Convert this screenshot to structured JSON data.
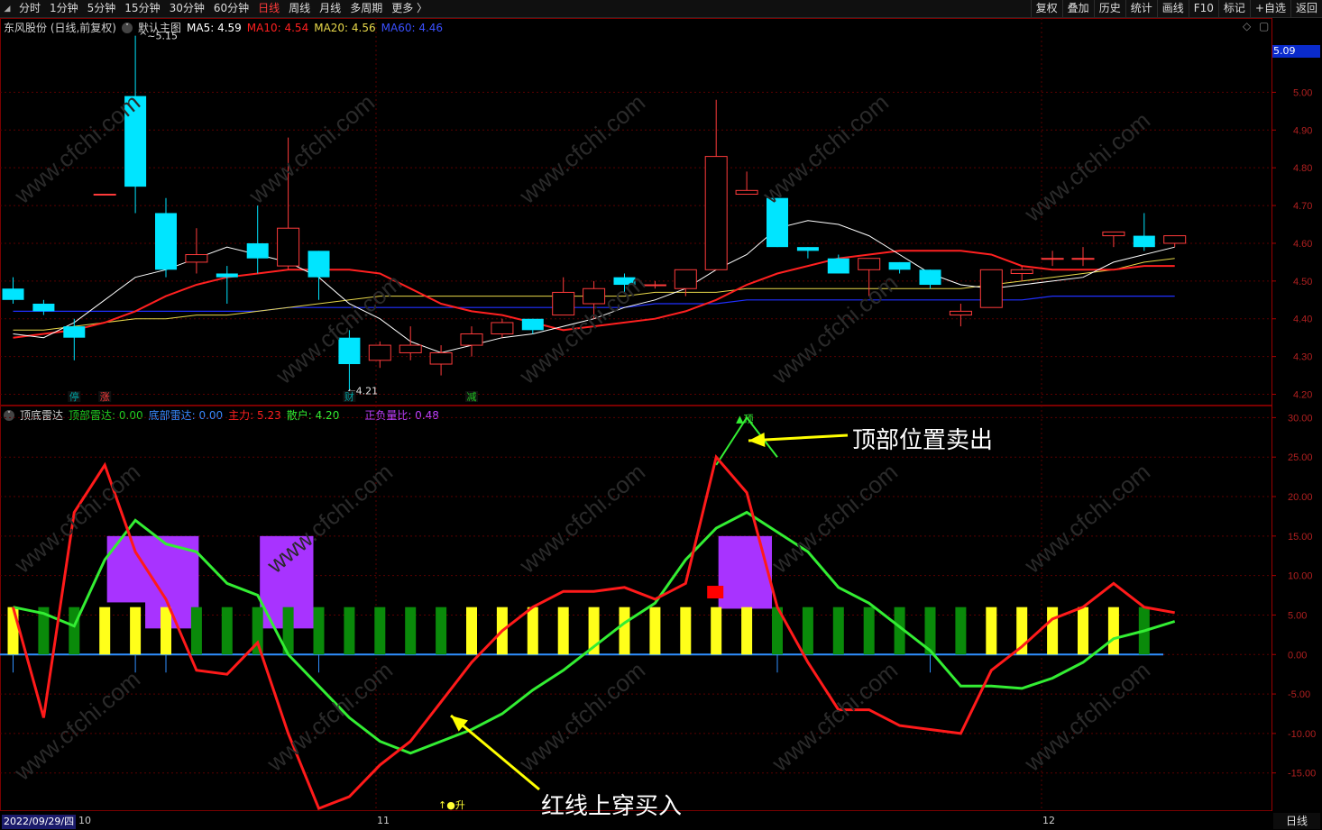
{
  "toolbar": {
    "left": [
      "分时",
      "1分钟",
      "5分钟",
      "15分钟",
      "30分钟",
      "60分钟",
      "日线",
      "周线",
      "月线",
      "多周期",
      "更多 〉"
    ],
    "active": "日线",
    "right": [
      "复权",
      "叠加",
      "历史",
      "统计",
      "画线",
      "F10",
      "标记",
      "+自选",
      "返回"
    ]
  },
  "main_legend": {
    "stock": "东风股份 (日线,前复权)",
    "template": "默认主图",
    "ma5": "MA5: 4.59",
    "ma10": "MA10: 4.54",
    "ma20": "MA20: 4.56",
    "ma60": "MA60: 4.46"
  },
  "sub_legend": {
    "name": "顶底雷达",
    "top": "顶部雷达: 0.00",
    "bottom": "底部雷达: 0.00",
    "main": "主力: 5.23",
    "retail": "散户: 4.20",
    "ratio": "正负量比: 0.48"
  },
  "current_price": "5.09",
  "markers": {
    "high": "5.15",
    "low": "←4.21",
    "tags": [
      "停",
      "涨",
      "财",
      "减"
    ],
    "top_signal": "顶",
    "bottom_signal": "↑●升"
  },
  "annotations": {
    "sell": "顶部位置卖出",
    "buy": "红线上穿买入"
  },
  "dates": {
    "start": "2022/09/29/四",
    "oct": "10",
    "nov": "11",
    "dec": "12"
  },
  "period_label": "日线",
  "watermark": "www.cfchi.com",
  "colors": {
    "up": "#ff3b3b",
    "down": "#00e5ff",
    "ma5": "#ffffff",
    "ma10": "#ff2020",
    "ma20": "#e8d84a",
    "ma60": "#2030ff",
    "main_line": "#ff1a1a",
    "retail_line": "#33ee33",
    "ratio_bar": "#a833ff",
    "bar_yellow": "#ffff1a",
    "bar_green": "#0a8a0a"
  },
  "chart_data": [
    {
      "type": "candlestick",
      "title": "东风股份 (日线,前复权)",
      "y_ticks": [
        5.0,
        4.9,
        4.8,
        4.7,
        4.6,
        4.5,
        4.4,
        4.3,
        4.2
      ],
      "ylim": [
        4.175,
        5.18
      ],
      "candles": [
        {
          "o": 4.48,
          "h": 4.51,
          "l": 4.44,
          "c": 4.45
        },
        {
          "o": 4.44,
          "h": 4.45,
          "l": 4.41,
          "c": 4.42
        },
        {
          "o": 4.38,
          "h": 4.4,
          "l": 4.29,
          "c": 4.35
        },
        {
          "o": 4.73,
          "h": 4.73,
          "l": 4.73,
          "c": 4.73
        },
        {
          "o": 4.99,
          "h": 5.15,
          "l": 4.68,
          "c": 4.75
        },
        {
          "o": 4.68,
          "h": 4.72,
          "l": 4.51,
          "c": 4.53
        },
        {
          "o": 4.55,
          "h": 4.64,
          "l": 4.52,
          "c": 4.57
        },
        {
          "o": 4.52,
          "h": 4.54,
          "l": 4.44,
          "c": 4.51
        },
        {
          "o": 4.6,
          "h": 4.7,
          "l": 4.52,
          "c": 4.56
        },
        {
          "o": 4.54,
          "h": 4.88,
          "l": 4.53,
          "c": 4.64
        },
        {
          "o": 4.58,
          "h": 4.58,
          "l": 4.45,
          "c": 4.51
        },
        {
          "o": 4.35,
          "h": 4.37,
          "l": 4.21,
          "c": 4.28
        },
        {
          "o": 4.29,
          "h": 4.34,
          "l": 4.27,
          "c": 4.33
        },
        {
          "o": 4.31,
          "h": 4.38,
          "l": 4.29,
          "c": 4.33
        },
        {
          "o": 4.28,
          "h": 4.33,
          "l": 4.25,
          "c": 4.31
        },
        {
          "o": 4.33,
          "h": 4.38,
          "l": 4.3,
          "c": 4.36
        },
        {
          "o": 4.36,
          "h": 4.4,
          "l": 4.35,
          "c": 4.39
        },
        {
          "o": 4.4,
          "h": 4.4,
          "l": 4.36,
          "c": 4.37
        },
        {
          "o": 4.41,
          "h": 4.51,
          "l": 4.41,
          "c": 4.47
        },
        {
          "o": 4.44,
          "h": 4.5,
          "l": 4.4,
          "c": 4.48
        },
        {
          "o": 4.51,
          "h": 4.52,
          "l": 4.47,
          "c": 4.49
        },
        {
          "o": 4.49,
          "h": 4.5,
          "l": 4.48,
          "c": 4.49
        },
        {
          "o": 4.48,
          "h": 4.5,
          "l": 4.46,
          "c": 4.53
        },
        {
          "o": 4.53,
          "h": 4.98,
          "l": 4.53,
          "c": 4.83
        },
        {
          "o": 4.73,
          "h": 4.79,
          "l": 4.73,
          "c": 4.74
        },
        {
          "o": 4.72,
          "h": 4.72,
          "l": 4.59,
          "c": 4.59
        },
        {
          "o": 4.59,
          "h": 4.59,
          "l": 4.56,
          "c": 4.58
        },
        {
          "o": 4.56,
          "h": 4.57,
          "l": 4.52,
          "c": 4.52
        },
        {
          "o": 4.53,
          "h": 4.56,
          "l": 4.46,
          "c": 4.56
        },
        {
          "o": 4.55,
          "h": 4.55,
          "l": 4.52,
          "c": 4.53
        },
        {
          "o": 4.53,
          "h": 4.53,
          "l": 4.48,
          "c": 4.49
        },
        {
          "o": 4.41,
          "h": 4.44,
          "l": 4.38,
          "c": 4.42
        },
        {
          "o": 4.43,
          "h": 4.53,
          "l": 4.43,
          "c": 4.53
        },
        {
          "o": 4.52,
          "h": 4.54,
          "l": 4.5,
          "c": 4.53
        },
        {
          "o": 4.56,
          "h": 4.58,
          "l": 4.54,
          "c": 4.56
        },
        {
          "o": 4.56,
          "h": 4.59,
          "l": 4.54,
          "c": 4.56
        },
        {
          "o": 4.62,
          "h": 4.63,
          "l": 4.59,
          "c": 4.63
        },
        {
          "o": 4.62,
          "h": 4.68,
          "l": 4.58,
          "c": 4.59
        },
        {
          "o": 4.6,
          "h": 4.62,
          "l": 4.59,
          "c": 4.62
        }
      ],
      "ma5": [
        4.36,
        4.35,
        4.39,
        4.45,
        4.51,
        4.53,
        4.56,
        4.59,
        4.57,
        4.55,
        4.51,
        4.44,
        4.4,
        4.34,
        4.31,
        4.33,
        4.35,
        4.36,
        4.38,
        4.4,
        4.43,
        4.45,
        4.48,
        4.53,
        4.57,
        4.64,
        4.66,
        4.65,
        4.62,
        4.57,
        4.52,
        4.49,
        4.48,
        4.49,
        4.5,
        4.51,
        4.55,
        4.57,
        4.59
      ],
      "ma10": [
        4.35,
        4.36,
        4.37,
        4.39,
        4.42,
        4.46,
        4.49,
        4.51,
        4.52,
        4.53,
        4.53,
        4.53,
        4.52,
        4.48,
        4.44,
        4.42,
        4.41,
        4.39,
        4.37,
        4.38,
        4.39,
        4.4,
        4.42,
        4.45,
        4.49,
        4.52,
        4.54,
        4.56,
        4.57,
        4.58,
        4.58,
        4.58,
        4.57,
        4.54,
        4.53,
        4.53,
        4.53,
        4.54,
        4.54
      ],
      "ma20": [
        4.37,
        4.37,
        4.38,
        4.39,
        4.4,
        4.4,
        4.41,
        4.41,
        4.42,
        4.43,
        4.44,
        4.45,
        4.46,
        4.46,
        4.46,
        4.46,
        4.46,
        4.46,
        4.46,
        4.46,
        4.46,
        4.47,
        4.47,
        4.47,
        4.48,
        4.48,
        4.48,
        4.48,
        4.48,
        4.48,
        4.48,
        4.48,
        4.49,
        4.5,
        4.51,
        4.52,
        4.53,
        4.55,
        4.56
      ],
      "ma60": [
        4.42,
        4.42,
        4.42,
        4.42,
        4.42,
        4.42,
        4.42,
        4.42,
        4.42,
        4.43,
        4.43,
        4.43,
        4.43,
        4.43,
        4.43,
        4.43,
        4.43,
        4.43,
        4.43,
        4.43,
        4.43,
        4.44,
        4.44,
        4.44,
        4.45,
        4.45,
        4.45,
        4.45,
        4.45,
        4.45,
        4.45,
        4.45,
        4.45,
        4.45,
        4.46,
        4.46,
        4.46,
        4.46,
        4.46
      ]
    },
    {
      "type": "line",
      "title": "顶底雷达",
      "y_ticks": [
        30,
        25,
        20,
        15,
        10,
        5,
        0,
        -5,
        -10,
        -15
      ],
      "ylim": [
        -19.6,
        31.3
      ],
      "main": [
        6,
        -8,
        18,
        24,
        13,
        7,
        -2,
        -2.5,
        1.5,
        -10,
        -19.5,
        -18,
        -14,
        -11,
        -6,
        -1,
        3,
        6,
        8,
        8,
        8.5,
        7,
        9,
        25,
        20.5,
        6,
        -1,
        -7,
        -7,
        -9,
        -9.5,
        -10,
        -2,
        1,
        4.5,
        6,
        9,
        6,
        5.3
      ],
      "retail": [
        6,
        5.2,
        3.6,
        12,
        17,
        14,
        13,
        9,
        7.5,
        0,
        -4,
        -8,
        -11,
        -12.5,
        -11,
        -9.5,
        -7.5,
        -4.5,
        -2,
        1,
        4,
        6.5,
        12,
        16,
        18,
        15.5,
        13,
        8.5,
        6.5,
        3.5,
        0.5,
        -4,
        -4,
        -4.3,
        -3,
        -1,
        2,
        3,
        4.2
      ],
      "top_radar_spike": [
        24,
        30,
        25
      ],
      "ratio_boxes": [
        {
          "x0": 6.5,
          "x1": 10.5,
          "top": 15,
          "bottom": 6.6
        },
        {
          "x0": 9,
          "x1": 12.5,
          "top": 15,
          "bottom": 3.3
        },
        {
          "x0": 16.5,
          "x1": 20,
          "top": 15,
          "bottom": 3.3
        },
        {
          "x0": 46.5,
          "x1": 50,
          "top": 15,
          "bottom": 5.8
        }
      ],
      "bars": [
        {
          "c": "y",
          "v": 6
        },
        {
          "c": "g",
          "v": 6
        },
        {
          "c": "g",
          "v": 6
        },
        {
          "c": "y",
          "v": 6
        },
        {
          "c": "y",
          "v": 6
        },
        {
          "c": "y",
          "v": 6
        },
        {
          "c": "g",
          "v": 6
        },
        {
          "c": "g",
          "v": 6
        },
        {
          "c": "g",
          "v": 6
        },
        {
          "c": "g",
          "v": 6
        },
        {
          "c": "g",
          "v": 6
        },
        {
          "c": "g",
          "v": 6
        },
        {
          "c": "g",
          "v": 6
        },
        {
          "c": "g",
          "v": 6
        },
        {
          "c": "g",
          "v": 6
        },
        {
          "c": "y",
          "v": 6
        },
        {
          "c": "y",
          "v": 6
        },
        {
          "c": "y",
          "v": 6
        },
        {
          "c": "y",
          "v": 6
        },
        {
          "c": "y",
          "v": 6
        },
        {
          "c": "y",
          "v": 6
        },
        {
          "c": "y",
          "v": 6
        },
        {
          "c": "y",
          "v": 6
        },
        {
          "c": "y",
          "v": 6
        },
        {
          "c": "y",
          "v": 6
        },
        {
          "c": "g",
          "v": 6
        },
        {
          "c": "g",
          "v": 6
        },
        {
          "c": "g",
          "v": 6
        },
        {
          "c": "g",
          "v": 6
        },
        {
          "c": "g",
          "v": 6
        },
        {
          "c": "g",
          "v": 6
        },
        {
          "c": "g",
          "v": 6
        },
        {
          "c": "y",
          "v": 6
        },
        {
          "c": "y",
          "v": 6
        },
        {
          "c": "y",
          "v": 6
        },
        {
          "c": "y",
          "v": 6
        },
        {
          "c": "y",
          "v": 6
        },
        {
          "c": "g",
          "v": 6
        }
      ]
    }
  ]
}
